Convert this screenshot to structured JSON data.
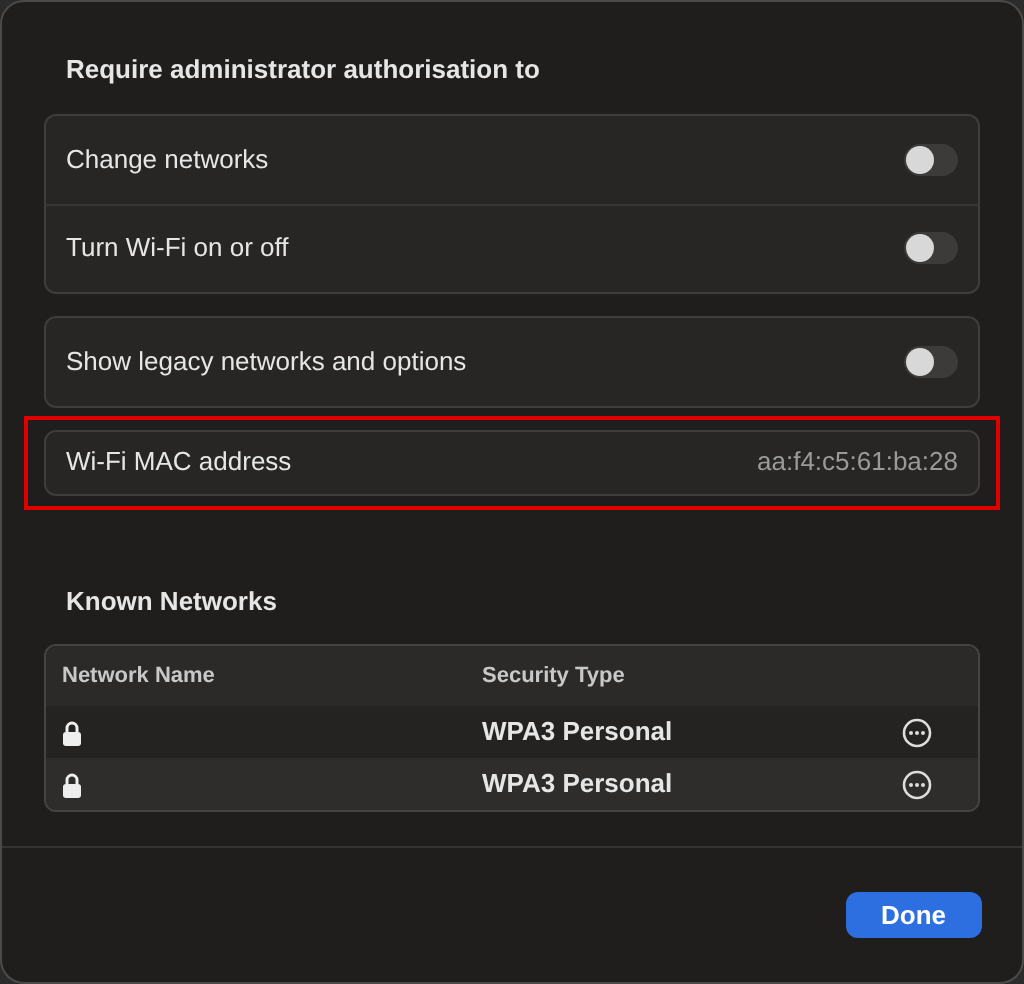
{
  "admin_section": {
    "title": "Require administrator authorisation to",
    "groups": [
      [
        {
          "label": "Change networks",
          "on": false
        },
        {
          "label": "Turn Wi-Fi on or off",
          "on": false
        }
      ],
      [
        {
          "label": "Show legacy networks and options",
          "on": false
        }
      ]
    ]
  },
  "mac_address": {
    "label": "Wi-Fi MAC address",
    "value": "aa:f4:c5:61:ba:28",
    "highlighted": true
  },
  "known_networks": {
    "title": "Known Networks",
    "columns": [
      "Network Name",
      "Security Type"
    ],
    "rows": [
      {
        "security": "WPA3 Personal",
        "locked": true
      },
      {
        "security": "WPA3 Personal",
        "locked": true
      }
    ]
  },
  "buttons": [
    "Done"
  ]
}
